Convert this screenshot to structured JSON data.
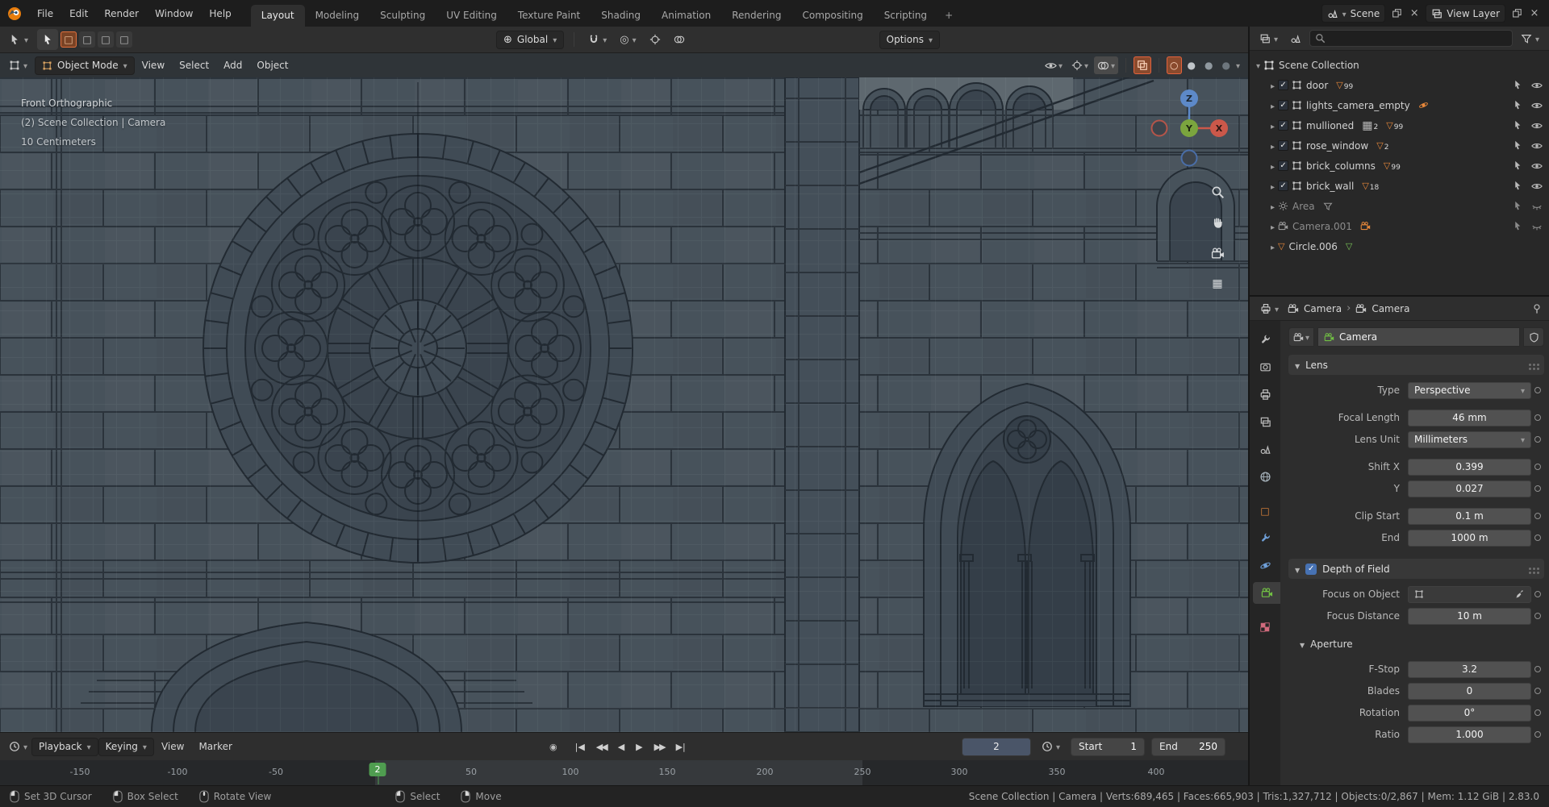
{
  "topbar": {
    "menus": {
      "file": "File",
      "edit": "Edit",
      "render": "Render",
      "window": "Window",
      "help": "Help"
    },
    "tabs": {
      "layout": "Layout",
      "modeling": "Modeling",
      "sculpting": "Sculpting",
      "uv": "UV Editing",
      "tex": "Texture Paint",
      "shading": "Shading",
      "anim": "Animation",
      "rendering": "Rendering",
      "comp": "Compositing",
      "script": "Scripting",
      "add": "+"
    },
    "scene_label": "Scene",
    "view_layer_label": "View Layer"
  },
  "tools": {
    "orientation": "Global",
    "options": "Options"
  },
  "viewport": {
    "mode": "Object Mode",
    "menus": {
      "view": "View",
      "select": "Select",
      "add": "Add",
      "object": "Object"
    },
    "overlay": {
      "view": "Front Orthographic",
      "context": "(2) Scene Collection | Camera",
      "scale": "10 Centimeters"
    },
    "axes": {
      "x": "X",
      "y": "Y",
      "z": "Z"
    }
  },
  "outliner": {
    "root": "Scene Collection",
    "items": [
      {
        "label": "door",
        "badge": "99"
      },
      {
        "label": "lights_camera_empty"
      },
      {
        "label": "mullioned",
        "badge2": "2",
        "badge": "99"
      },
      {
        "label": "rose_window",
        "badge": "2"
      },
      {
        "label": "brick_columns",
        "badge": "99"
      },
      {
        "label": "brick_wall",
        "badge": "18"
      },
      {
        "label": "Area"
      },
      {
        "label": "Camera.001"
      },
      {
        "label": "Circle.006"
      }
    ]
  },
  "properties": {
    "breadcrumb1": "Camera",
    "breadcrumb2": "Camera",
    "id_name": "Camera",
    "lens_title": "Lens",
    "rows": {
      "type": {
        "label": "Type",
        "value": "Perspective"
      },
      "focal": {
        "label": "Focal Length",
        "value": "46 mm"
      },
      "unit": {
        "label": "Lens Unit",
        "value": "Millimeters"
      },
      "shiftx": {
        "label": "Shift X",
        "value": "0.399"
      },
      "shifty": {
        "label": "Y",
        "value": "0.027"
      },
      "clipstart": {
        "label": "Clip Start",
        "value": "0.1 m"
      },
      "clipend": {
        "label": "End",
        "value": "1000 m"
      }
    },
    "dof_title": "Depth of Field",
    "dof": {
      "focus_obj": {
        "label": "Focus on Object",
        "value": ""
      },
      "focus_dist": {
        "label": "Focus Distance",
        "value": "10 m"
      }
    },
    "aperture_title": "Aperture",
    "aperture": {
      "fstop": {
        "label": "F-Stop",
        "value": "3.2"
      },
      "blades": {
        "label": "Blades",
        "value": "0"
      },
      "rotation": {
        "label": "Rotation",
        "value": "0°"
      },
      "ratio": {
        "label": "Ratio",
        "value": "1.000"
      }
    }
  },
  "timeline": {
    "menus": {
      "playback": "Playback",
      "keying": "Keying",
      "view": "View",
      "marker": "Marker"
    },
    "frame": "2",
    "start_label": "Start",
    "start": "1",
    "end_label": "End",
    "end": "250",
    "ticks": [
      "-150",
      "-100",
      "-50",
      "50",
      "100",
      "150",
      "200",
      "250",
      "300",
      "350",
      "400"
    ],
    "current": "2"
  },
  "status": {
    "hints": [
      "Set 3D Cursor",
      "Box Select",
      "Rotate View",
      "Select",
      "Move"
    ],
    "info": "Scene Collection | Camera | Verts:689,465 | Faces:665,903 | Tris:1,327,712 | Objects:0/2,867 | Mem: 1.12 GiB | 2.83.0"
  }
}
